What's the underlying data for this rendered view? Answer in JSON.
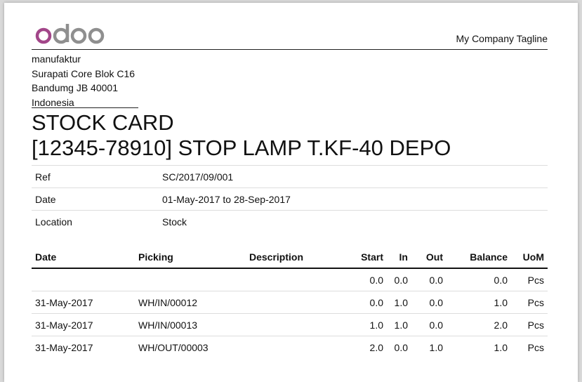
{
  "header": {
    "logo_text": "odoo",
    "tagline": "My Company Tagline"
  },
  "company": {
    "name": "manufaktur",
    "street": "Surapati Core Blok C16",
    "city": "Bandumg JB 40001",
    "country": "Indonesia"
  },
  "report": {
    "title": "STOCK CARD",
    "product": "[12345-78910] STOP LAMP T.KF-40 DEPO"
  },
  "info": [
    {
      "label": "Ref",
      "value": "SC/2017/09/001"
    },
    {
      "label": "Date",
      "value": "01-May-2017 to 28-Sep-2017"
    },
    {
      "label": "Location",
      "value": "Stock"
    }
  ],
  "table": {
    "headers": [
      "Date",
      "Picking",
      "Description",
      "Start",
      "In",
      "Out",
      "Balance",
      "UoM"
    ],
    "rows": [
      [
        "",
        "",
        "",
        "0.0",
        "0.0",
        "0.0",
        "0.0",
        "Pcs"
      ],
      [
        "31-May-2017",
        "WH/IN/00012",
        "",
        "0.0",
        "1.0",
        "0.0",
        "1.0",
        "Pcs"
      ],
      [
        "31-May-2017",
        "WH/IN/00013",
        "",
        "1.0",
        "1.0",
        "0.0",
        "2.0",
        "Pcs"
      ],
      [
        "31-May-2017",
        "WH/OUT/00003",
        "",
        "2.0",
        "0.0",
        "1.0",
        "1.0",
        "Pcs"
      ]
    ]
  },
  "colors": {
    "logo_purple": "#a24689",
    "logo_gray": "#8f8f8f"
  }
}
